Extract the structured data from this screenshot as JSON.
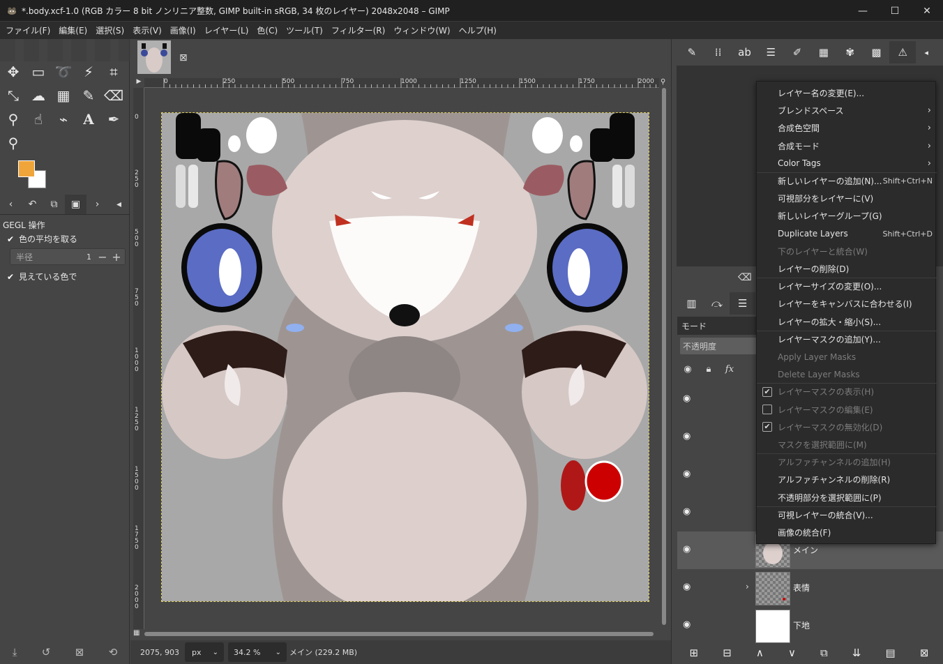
{
  "window": {
    "title": "*.body.xcf-1.0 (RGB カラー 8 bit ノンリニア整数, GIMP built-in sRGB, 34 枚のレイヤー) 2048x2048 – GIMP",
    "minimize": "—",
    "maximize": "☐",
    "close": "✕"
  },
  "menubar": [
    "ファイル(F)",
    "編集(E)",
    "選択(S)",
    "表示(V)",
    "画像(I)",
    "レイヤー(L)",
    "色(C)",
    "ツール(T)",
    "フィルター(R)",
    "ウィンドウ(W)",
    "ヘルプ(H)"
  ],
  "toolbox": {
    "gegl_title": "GEGL 操作",
    "sample_average": "色の平均を取る",
    "radius_label": "半径",
    "radius_value": "1",
    "sample_merged": "見えている色で"
  },
  "colors": {
    "foreground": "#f0a53a",
    "background": "#ffffff"
  },
  "canvas": {
    "ruler_h": [
      "0",
      "250",
      "500",
      "750",
      "1000",
      "1250",
      "1500",
      "1750",
      "2000"
    ],
    "ruler_v": [
      "0",
      "250",
      "500",
      "750",
      "1000",
      "1250",
      "1500",
      "1750",
      "2000"
    ]
  },
  "status": {
    "coords": "2075, 903",
    "unit": "px",
    "zoom": "34.2 %",
    "layer_info": "メイン (229.2 MB)"
  },
  "layers_panel": {
    "mode_label": "モード",
    "opacity_label": "不透明度",
    "layers": [
      {
        "name": ""
      },
      {
        "name": ""
      },
      {
        "name": ""
      },
      {
        "name": ""
      },
      {
        "name": "メイン"
      },
      {
        "name": "表情"
      },
      {
        "name": "下地"
      }
    ]
  },
  "context_menu": {
    "items": [
      {
        "label": "レイヤー名の変更(E)...",
        "shortcut": "",
        "submenu": false,
        "disabled": false,
        "check": null
      },
      {
        "label": "ブレンドスペース",
        "shortcut": "",
        "submenu": true,
        "disabled": false,
        "check": null
      },
      {
        "label": "合成色空間",
        "shortcut": "",
        "submenu": true,
        "disabled": false,
        "check": null
      },
      {
        "label": "合成モード",
        "shortcut": "",
        "submenu": true,
        "disabled": false,
        "check": null
      },
      {
        "label": "Color Tags",
        "shortcut": "",
        "submenu": true,
        "disabled": false,
        "check": null
      },
      {
        "label": "新しいレイヤーの追加(N)...",
        "shortcut": "Shift+Ctrl+N",
        "submenu": false,
        "disabled": false,
        "check": null
      },
      {
        "label": "可視部分をレイヤーに(V)",
        "shortcut": "",
        "submenu": false,
        "disabled": false,
        "check": null
      },
      {
        "label": "新しいレイヤーグループ(G)",
        "shortcut": "",
        "submenu": false,
        "disabled": false,
        "check": null
      },
      {
        "label": "Duplicate Layers",
        "shortcut": "Shift+Ctrl+D",
        "submenu": false,
        "disabled": false,
        "check": null
      },
      {
        "label": "下のレイヤーと統合(W)",
        "shortcut": "",
        "submenu": false,
        "disabled": true,
        "check": null
      },
      {
        "label": "レイヤーの削除(D)",
        "shortcut": "",
        "submenu": false,
        "disabled": false,
        "check": null
      },
      {
        "label": "レイヤーサイズの変更(O)...",
        "shortcut": "",
        "submenu": false,
        "disabled": false,
        "check": null
      },
      {
        "label": "レイヤーをキャンバスに合わせる(I)",
        "shortcut": "",
        "submenu": false,
        "disabled": false,
        "check": null
      },
      {
        "label": "レイヤーの拡大・縮小(S)...",
        "shortcut": "",
        "submenu": false,
        "disabled": false,
        "check": null
      },
      {
        "label": "レイヤーマスクの追加(Y)...",
        "shortcut": "",
        "submenu": false,
        "disabled": false,
        "check": null
      },
      {
        "label": "Apply Layer Masks",
        "shortcut": "",
        "submenu": false,
        "disabled": true,
        "check": null
      },
      {
        "label": "Delete Layer Masks",
        "shortcut": "",
        "submenu": false,
        "disabled": true,
        "check": null
      },
      {
        "label": "レイヤーマスクの表示(H)",
        "shortcut": "",
        "submenu": false,
        "disabled": true,
        "check": true
      },
      {
        "label": "レイヤーマスクの編集(E)",
        "shortcut": "",
        "submenu": false,
        "disabled": true,
        "check": false
      },
      {
        "label": "レイヤーマスクの無効化(D)",
        "shortcut": "",
        "submenu": false,
        "disabled": true,
        "check": true
      },
      {
        "label": "マスクを選択範囲に(M)",
        "shortcut": "",
        "submenu": false,
        "disabled": true,
        "check": null
      },
      {
        "label": "アルファチャンネルの追加(H)",
        "shortcut": "",
        "submenu": false,
        "disabled": true,
        "check": null
      },
      {
        "label": "アルファチャンネルの削除(R)",
        "shortcut": "",
        "submenu": false,
        "disabled": false,
        "check": null
      },
      {
        "label": "不透明部分を選択範囲に(P)",
        "shortcut": "",
        "submenu": false,
        "disabled": false,
        "check": null
      },
      {
        "label": "可視レイヤーの統合(V)...",
        "shortcut": "",
        "submenu": false,
        "disabled": false,
        "check": null
      },
      {
        "label": "画像の統合(F)",
        "shortcut": "",
        "submenu": false,
        "disabled": false,
        "check": null
      }
    ]
  }
}
